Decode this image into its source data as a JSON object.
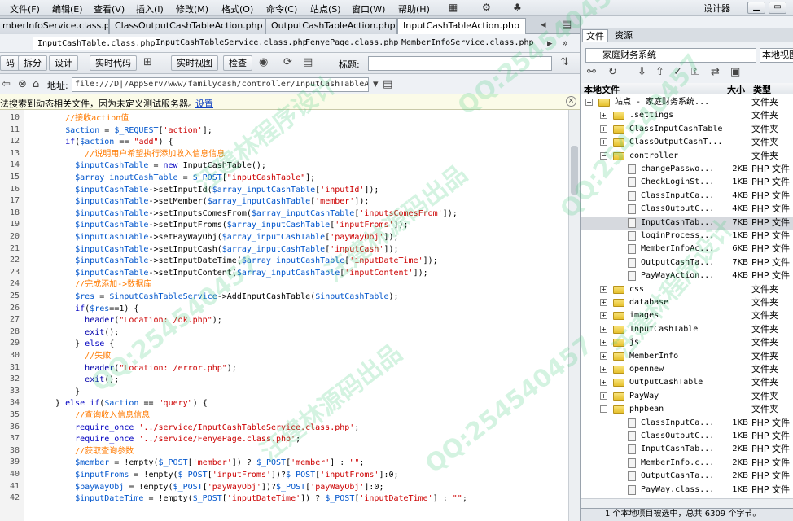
{
  "menu": [
    "文件(F)",
    "编辑(E)",
    "查看(V)",
    "插入(I)",
    "修改(M)",
    "格式(O)",
    "命令(C)",
    "站点(S)",
    "窗口(W)",
    "帮助(H)"
  ],
  "workspace": "设计器",
  "doc_tabs": [
    {
      "label": "mberInfoService.class.php",
      "close": "×"
    },
    {
      "label": "ClassOutputCashTableAction.php",
      "close": "×"
    },
    {
      "label": "OutputCashTableAction.php",
      "close": "×"
    },
    {
      "label": "InputCashTableAction.php",
      "close": "×"
    }
  ],
  "related_files": [
    "InputCashTable.class.php",
    "InputCashTableService.class.php",
    "FenyePage.class.php",
    "MemberInfoService.class.php"
  ],
  "toolbar": {
    "code": "码",
    "split": "拆分",
    "design": "设计",
    "live_code": "实时代码",
    "live_view": "实时视图",
    "inspect": "检查",
    "title_label": "标题:"
  },
  "address": {
    "label": "地址:",
    "value": "file:///D|/AppServ/www/familycash/controller/InputCashTableActi"
  },
  "info": {
    "text": "法搜索到动态相关文件，因为未定义测试服务器。",
    "link": "设置"
  },
  "code_lines": [
    {
      "n": "10",
      "ind": "    ",
      "parts": [
        [
          "cm",
          "//接收action值"
        ]
      ]
    },
    {
      "n": "11",
      "ind": "    ",
      "parts": [
        [
          "var",
          "$action"
        ],
        [
          "op",
          " = "
        ],
        [
          "var",
          "$_REQUEST"
        ],
        [
          "op",
          "["
        ],
        [
          "str",
          "'action'"
        ],
        [
          "op",
          "];"
        ]
      ]
    },
    {
      "n": "12",
      "ind": "    ",
      "parts": [
        [
          "kw",
          "if"
        ],
        [
          "op",
          "("
        ],
        [
          "var",
          "$action"
        ],
        [
          "op",
          " == "
        ],
        [
          "str",
          "\"add\""
        ],
        [
          "op",
          ") {"
        ]
      ]
    },
    {
      "n": "13",
      "ind": "        ",
      "parts": [
        [
          "cm",
          "//说明用户希望执行添加收入信息信息"
        ]
      ]
    },
    {
      "n": "14",
      "ind": "      ",
      "parts": [
        [
          "var",
          "$inputCashTable"
        ],
        [
          "op",
          " = "
        ],
        [
          "kw",
          "new"
        ],
        [
          "op",
          " InputCashTable();"
        ]
      ]
    },
    {
      "n": "15",
      "ind": "      ",
      "parts": [
        [
          "var",
          "$array_inputCashTable"
        ],
        [
          "op",
          " = "
        ],
        [
          "var",
          "$_POST"
        ],
        [
          "op",
          "["
        ],
        [
          "str",
          "\"inputCashTable\""
        ],
        [
          "op",
          "];"
        ]
      ]
    },
    {
      "n": "16",
      "ind": "      ",
      "parts": [
        [
          "var",
          "$inputCashTable"
        ],
        [
          "op",
          "->setInputId("
        ],
        [
          "var",
          "$array_inputCashTable"
        ],
        [
          "op",
          "["
        ],
        [
          "str",
          "'inputId'"
        ],
        [
          "op",
          "]);"
        ]
      ]
    },
    {
      "n": "17",
      "ind": "      ",
      "parts": [
        [
          "var",
          "$inputCashTable"
        ],
        [
          "op",
          "->setMember("
        ],
        [
          "var",
          "$array_inputCashTable"
        ],
        [
          "op",
          "["
        ],
        [
          "str",
          "'member'"
        ],
        [
          "op",
          "]);"
        ]
      ]
    },
    {
      "n": "18",
      "ind": "      ",
      "parts": [
        [
          "var",
          "$inputCashTable"
        ],
        [
          "op",
          "->setInputsComesFrom("
        ],
        [
          "var",
          "$array_inputCashTable"
        ],
        [
          "op",
          "["
        ],
        [
          "str",
          "'inputsComesFrom'"
        ],
        [
          "op",
          "]);"
        ]
      ]
    },
    {
      "n": "19",
      "ind": "      ",
      "parts": [
        [
          "var",
          "$inputCashTable"
        ],
        [
          "op",
          "->setInputFroms("
        ],
        [
          "var",
          "$array_inputCashTable"
        ],
        [
          "op",
          "["
        ],
        [
          "str",
          "'inputFroms'"
        ],
        [
          "op",
          "]);"
        ]
      ]
    },
    {
      "n": "20",
      "ind": "      ",
      "parts": [
        [
          "var",
          "$inputCashTable"
        ],
        [
          "op",
          "->setPayWayObj("
        ],
        [
          "var",
          "$array_inputCashTable"
        ],
        [
          "op",
          "["
        ],
        [
          "str",
          "'payWayObj'"
        ],
        [
          "op",
          "]);"
        ]
      ]
    },
    {
      "n": "21",
      "ind": "      ",
      "parts": [
        [
          "var",
          "$inputCashTable"
        ],
        [
          "op",
          "->setInputCash("
        ],
        [
          "var",
          "$array_inputCashTable"
        ],
        [
          "op",
          "["
        ],
        [
          "str",
          "'inputCash'"
        ],
        [
          "op",
          "]);"
        ]
      ]
    },
    {
      "n": "22",
      "ind": "      ",
      "parts": [
        [
          "var",
          "$inputCashTable"
        ],
        [
          "op",
          "->setInputDateTime("
        ],
        [
          "var",
          "$array_inputCashTable"
        ],
        [
          "op",
          "["
        ],
        [
          "str",
          "'inputDateTime'"
        ],
        [
          "op",
          "]);"
        ]
      ]
    },
    {
      "n": "23",
      "ind": "      ",
      "parts": [
        [
          "var",
          "$inputCashTable"
        ],
        [
          "op",
          "->setInputContent("
        ],
        [
          "var",
          "$array_inputCashTable"
        ],
        [
          "op",
          "["
        ],
        [
          "str",
          "'inputContent'"
        ],
        [
          "op",
          "]);"
        ]
      ]
    },
    {
      "n": "24",
      "ind": "      ",
      "parts": [
        [
          "cm",
          "//完成添加->数据库"
        ]
      ]
    },
    {
      "n": "25",
      "ind": "      ",
      "parts": [
        [
          "var",
          "$res"
        ],
        [
          "op",
          " = "
        ],
        [
          "var",
          "$inputCashTableService"
        ],
        [
          "op",
          "->AddInputCashTable("
        ],
        [
          "var",
          "$inputCashTable"
        ],
        [
          "op",
          ");"
        ]
      ]
    },
    {
      "n": "26",
      "ind": "      ",
      "parts": [
        [
          "kw",
          "if"
        ],
        [
          "op",
          "("
        ],
        [
          "var",
          "$res"
        ],
        [
          "op",
          "==1) {"
        ]
      ]
    },
    {
      "n": "27",
      "ind": "        ",
      "parts": [
        [
          "fn",
          "header"
        ],
        [
          "op",
          "("
        ],
        [
          "str",
          "\"Location: /ok.php\""
        ],
        [
          "op",
          ");"
        ]
      ]
    },
    {
      "n": "28",
      "ind": "        ",
      "parts": [
        [
          "fn",
          "exit"
        ],
        [
          "op",
          "();"
        ]
      ]
    },
    {
      "n": "29",
      "ind": "      ",
      "parts": [
        [
          "op",
          "} "
        ],
        [
          "kw",
          "else"
        ],
        [
          "op",
          " {"
        ]
      ]
    },
    {
      "n": "30",
      "ind": "        ",
      "parts": [
        [
          "cm",
          "//失败"
        ]
      ]
    },
    {
      "n": "31",
      "ind": "        ",
      "parts": [
        [
          "fn",
          "header"
        ],
        [
          "op",
          "("
        ],
        [
          "str",
          "\"Location: /error.php\""
        ],
        [
          "op",
          ");"
        ]
      ]
    },
    {
      "n": "32",
      "ind": "        ",
      "parts": [
        [
          "fn",
          "exit"
        ],
        [
          "op",
          "();"
        ]
      ]
    },
    {
      "n": "33",
      "ind": "      ",
      "parts": [
        [
          "op",
          "}"
        ]
      ]
    },
    {
      "n": "34",
      "ind": "  ",
      "parts": [
        [
          "op",
          "} "
        ],
        [
          "kw",
          "else if"
        ],
        [
          "op",
          "("
        ],
        [
          "var",
          "$action"
        ],
        [
          "op",
          " == "
        ],
        [
          "str",
          "\"query\""
        ],
        [
          "op",
          ") {"
        ]
      ]
    },
    {
      "n": "35",
      "ind": "      ",
      "parts": [
        [
          "cm",
          "//查询收入信息信息"
        ]
      ]
    },
    {
      "n": "36",
      "ind": "      ",
      "parts": [
        [
          "kw",
          "require_once"
        ],
        [
          "op",
          " "
        ],
        [
          "str",
          "'../service/InputCashTableService.class.php'"
        ],
        [
          "op",
          ";"
        ]
      ]
    },
    {
      "n": "37",
      "ind": "      ",
      "parts": [
        [
          "kw",
          "require_once"
        ],
        [
          "op",
          " "
        ],
        [
          "str",
          "'../service/FenyePage.class.php'"
        ],
        [
          "op",
          ";"
        ]
      ]
    },
    {
      "n": "38",
      "ind": "      ",
      "parts": [
        [
          "cm",
          "//获取查询参数"
        ]
      ]
    },
    {
      "n": "39",
      "ind": "      ",
      "parts": [
        [
          "var",
          "$member"
        ],
        [
          "op",
          " = !empty("
        ],
        [
          "var",
          "$_POST"
        ],
        [
          "op",
          "["
        ],
        [
          "str",
          "'member'"
        ],
        [
          "op",
          "]) ? "
        ],
        [
          "var",
          "$_POST"
        ],
        [
          "op",
          "["
        ],
        [
          "str",
          "'member'"
        ],
        [
          "op",
          "] : "
        ],
        [
          "str",
          "\"\""
        ],
        [
          "op",
          ";"
        ]
      ]
    },
    {
      "n": "40",
      "ind": "      ",
      "parts": [
        [
          "var",
          "$inputFroms"
        ],
        [
          "op",
          " = !empty("
        ],
        [
          "var",
          "$_POST"
        ],
        [
          "op",
          "["
        ],
        [
          "str",
          "'inputFroms'"
        ],
        [
          "op",
          "])?"
        ],
        [
          "var",
          "$_POST"
        ],
        [
          "op",
          "["
        ],
        [
          "str",
          "'inputFroms'"
        ],
        [
          "op",
          "]:0;"
        ]
      ]
    },
    {
      "n": "41",
      "ind": "      ",
      "parts": [
        [
          "var",
          "$payWayObj"
        ],
        [
          "op",
          " = !empty("
        ],
        [
          "var",
          "$_POST"
        ],
        [
          "op",
          "["
        ],
        [
          "str",
          "'payWayObj'"
        ],
        [
          "op",
          "])?"
        ],
        [
          "var",
          "$_POST"
        ],
        [
          "op",
          "["
        ],
        [
          "str",
          "'payWayObj'"
        ],
        [
          "op",
          "]:0;"
        ]
      ]
    },
    {
      "n": "42",
      "ind": "      ",
      "parts": [
        [
          "var",
          "$inputDateTime"
        ],
        [
          "op",
          " = !empty("
        ],
        [
          "var",
          "$_POST"
        ],
        [
          "op",
          "["
        ],
        [
          "str",
          "'inputDateTime'"
        ],
        [
          "op",
          "]) ? "
        ],
        [
          "var",
          "$_POST"
        ],
        [
          "op",
          "["
        ],
        [
          "str",
          "'inputDateTime'"
        ],
        [
          "op",
          "] : "
        ],
        [
          "str",
          "\"\""
        ],
        [
          "op",
          ";"
        ]
      ]
    }
  ],
  "panel": {
    "tabs": [
      "文件",
      "资源"
    ],
    "site": "家庭财务系统",
    "view": "本地视图",
    "headers": {
      "name": "本地文件",
      "size": "大小",
      "type": "类型"
    }
  },
  "tree": [
    {
      "depth": 0,
      "tog": "−",
      "kind": "folder",
      "name": "站点 - 家庭财务系统...",
      "size": "",
      "type": "文件夹"
    },
    {
      "depth": 1,
      "tog": "+",
      "kind": "folder",
      "name": ".settings",
      "size": "",
      "type": "文件夹"
    },
    {
      "depth": 1,
      "tog": "+",
      "kind": "folder",
      "name": "ClassInputCashTable",
      "size": "",
      "type": "文件夹"
    },
    {
      "depth": 1,
      "tog": "+",
      "kind": "folder",
      "name": "ClassOutputCashT...",
      "size": "",
      "type": "文件夹"
    },
    {
      "depth": 1,
      "tog": "−",
      "kind": "folder",
      "name": "controller",
      "size": "",
      "type": "文件夹"
    },
    {
      "depth": 2,
      "tog": "",
      "kind": "php",
      "name": "changePasswo...",
      "size": "2KB",
      "type": "PHP 文件"
    },
    {
      "depth": 2,
      "tog": "",
      "kind": "php",
      "name": "CheckLoginSt...",
      "size": "1KB",
      "type": "PHP 文件"
    },
    {
      "depth": 2,
      "tog": "",
      "kind": "php",
      "name": "ClassInputCa...",
      "size": "4KB",
      "type": "PHP 文件"
    },
    {
      "depth": 2,
      "tog": "",
      "kind": "php",
      "name": "ClassOutputC...",
      "size": "4KB",
      "type": "PHP 文件"
    },
    {
      "depth": 2,
      "tog": "",
      "kind": "php",
      "name": "InputCashTab...",
      "size": "7KB",
      "type": "PHP 文件",
      "sel": true
    },
    {
      "depth": 2,
      "tog": "",
      "kind": "php",
      "name": "loginProcess...",
      "size": "1KB",
      "type": "PHP 文件"
    },
    {
      "depth": 2,
      "tog": "",
      "kind": "php",
      "name": "MemberInfoAc...",
      "size": "6KB",
      "type": "PHP 文件"
    },
    {
      "depth": 2,
      "tog": "",
      "kind": "php",
      "name": "OutputCashTa...",
      "size": "7KB",
      "type": "PHP 文件"
    },
    {
      "depth": 2,
      "tog": "",
      "kind": "php",
      "name": "PayWayAction...",
      "size": "4KB",
      "type": "PHP 文件"
    },
    {
      "depth": 1,
      "tog": "+",
      "kind": "folder",
      "name": "css",
      "size": "",
      "type": "文件夹"
    },
    {
      "depth": 1,
      "tog": "+",
      "kind": "folder",
      "name": "database",
      "size": "",
      "type": "文件夹"
    },
    {
      "depth": 1,
      "tog": "+",
      "kind": "folder",
      "name": "images",
      "size": "",
      "type": "文件夹"
    },
    {
      "depth": 1,
      "tog": "+",
      "kind": "folder",
      "name": "InputCashTable",
      "size": "",
      "type": "文件夹"
    },
    {
      "depth": 1,
      "tog": "+",
      "kind": "folder",
      "name": "js",
      "size": "",
      "type": "文件夹"
    },
    {
      "depth": 1,
      "tog": "+",
      "kind": "folder",
      "name": "MemberInfo",
      "size": "",
      "type": "文件夹"
    },
    {
      "depth": 1,
      "tog": "+",
      "kind": "folder",
      "name": "opennew",
      "size": "",
      "type": "文件夹"
    },
    {
      "depth": 1,
      "tog": "+",
      "kind": "folder",
      "name": "OutputCashTable",
      "size": "",
      "type": "文件夹"
    },
    {
      "depth": 1,
      "tog": "+",
      "kind": "folder",
      "name": "PayWay",
      "size": "",
      "type": "文件夹"
    },
    {
      "depth": 1,
      "tog": "−",
      "kind": "folder",
      "name": "phpbean",
      "size": "",
      "type": "文件夹"
    },
    {
      "depth": 2,
      "tog": "",
      "kind": "php",
      "name": "ClassInputCa...",
      "size": "1KB",
      "type": "PHP 文件"
    },
    {
      "depth": 2,
      "tog": "",
      "kind": "php",
      "name": "ClassOutputC...",
      "size": "1KB",
      "type": "PHP 文件"
    },
    {
      "depth": 2,
      "tog": "",
      "kind": "php",
      "name": "InputCashTab...",
      "size": "2KB",
      "type": "PHP 文件"
    },
    {
      "depth": 2,
      "tog": "",
      "kind": "php",
      "name": "MemberInfo.c...",
      "size": "2KB",
      "type": "PHP 文件"
    },
    {
      "depth": 2,
      "tog": "",
      "kind": "php",
      "name": "OutputCashTa...",
      "size": "2KB",
      "type": "PHP 文件"
    },
    {
      "depth": 2,
      "tog": "",
      "kind": "php",
      "name": "PayWay.class...",
      "size": "1KB",
      "type": "PHP 文件"
    }
  ],
  "status": "1 个本地项目被选中，总共 6309 个字节。",
  "watermarks": [
    "QQ:254540457",
    "汪建林程序设计",
    "汪建林源码出品",
    "QQ:254540457",
    "QQ:254540457",
    "汪建林程序设计",
    "QQ:254540457",
    "汪建林源码出品"
  ]
}
